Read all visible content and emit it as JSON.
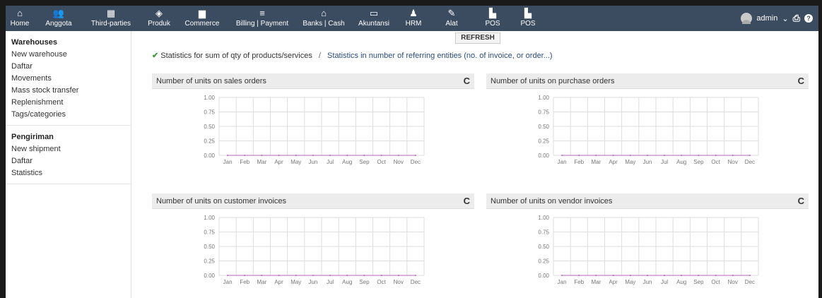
{
  "nav": {
    "items": [
      {
        "label": "Home",
        "icon": "house-icon",
        "glyph": "⌂"
      },
      {
        "label": "Anggota",
        "icon": "members-icon",
        "glyph": "👥"
      },
      {
        "label": "Third-parties",
        "icon": "building-icon",
        "glyph": "▦"
      },
      {
        "label": "Produk",
        "icon": "cube-icon",
        "glyph": "◈"
      },
      {
        "label": "Commerce",
        "icon": "briefcase-icon",
        "glyph": "▆"
      },
      {
        "label": "Billing | Payment",
        "icon": "coins-icon",
        "glyph": "≡"
      },
      {
        "label": "Banks | Cash",
        "icon": "bank-icon",
        "glyph": "⌂"
      },
      {
        "label": "Akuntansi",
        "icon": "calculator-icon",
        "glyph": "▭"
      },
      {
        "label": "HRM",
        "icon": "user-icon",
        "glyph": "♟"
      },
      {
        "label": "Alat",
        "icon": "wrench-icon",
        "glyph": "✎"
      },
      {
        "label": "POS",
        "icon": "pos-icon",
        "glyph": "▙"
      },
      {
        "label": "POS",
        "icon": "pos-icon",
        "glyph": "▙"
      }
    ],
    "active_index": 3,
    "user": "admin",
    "user_caret": "⌄",
    "print_glyph": "⎙",
    "help_glyph": "?"
  },
  "refresh_label": "REFRESH",
  "leftmenu": {
    "warehouses_title": "Warehouses",
    "warehouse_links": [
      "New warehouse",
      "Daftar",
      "Movements",
      "Mass stock transfer",
      "Replenishment",
      "Tags/categories"
    ],
    "shipping_title": "Pengiriman",
    "shipping_links": [
      "New shipment",
      "Daftar",
      "Statistics"
    ]
  },
  "stats": {
    "check": "✔",
    "current": "Statistics for sum of qty of products/services",
    "separator": "/",
    "alternative": "Statistics in number of referring entities (no. of invoice, or order...)"
  },
  "panels": [
    {
      "title": "Number of units on sales orders",
      "reload": "C"
    },
    {
      "title": "Number of units on purchase orders",
      "reload": "C"
    },
    {
      "title": "Number of units on customer invoices",
      "reload": "C"
    },
    {
      "title": "Number of units on vendor invoices",
      "reload": "C"
    }
  ],
  "colors": {
    "nav_bg": "#3b4b60",
    "line_color": "#b566b5",
    "grid": "#dddddd"
  },
  "chart_data": [
    {
      "type": "line",
      "categories": [
        "Jan",
        "Feb",
        "Mar",
        "Apr",
        "May",
        "Jun",
        "Jul",
        "Aug",
        "Sep",
        "Oct",
        "Nov",
        "Dec"
      ],
      "series": [
        {
          "values": [
            0,
            0,
            0,
            0,
            0,
            0,
            0,
            0,
            0,
            0,
            0,
            0
          ]
        }
      ],
      "yticks": [
        "1.00",
        "0.75",
        "0.50",
        "0.25",
        "0.00"
      ],
      "ylim": [
        0,
        1
      ],
      "grid": true
    },
    {
      "type": "line",
      "categories": [
        "Jan",
        "Feb",
        "Mar",
        "Apr",
        "May",
        "Jun",
        "Jul",
        "Aug",
        "Sep",
        "Oct",
        "Nov",
        "Dec"
      ],
      "series": [
        {
          "values": [
            0,
            0,
            0,
            0,
            0,
            0,
            0,
            0,
            0,
            0,
            0,
            0
          ]
        }
      ],
      "yticks": [
        "1.00",
        "0.75",
        "0.50",
        "0.25",
        "0.00"
      ],
      "ylim": [
        0,
        1
      ],
      "grid": true
    },
    {
      "type": "line",
      "categories": [
        "Jan",
        "Feb",
        "Mar",
        "Apr",
        "May",
        "Jun",
        "Jul",
        "Aug",
        "Sep",
        "Oct",
        "Nov",
        "Dec"
      ],
      "series": [
        {
          "values": [
            0,
            0,
            0,
            0,
            0,
            0,
            0,
            0,
            0,
            0,
            0,
            0
          ]
        }
      ],
      "yticks": [
        "1.00",
        "0.75",
        "0.50",
        "0.25",
        "0.00"
      ],
      "ylim": [
        0,
        1
      ],
      "grid": true
    },
    {
      "type": "line",
      "categories": [
        "Jan",
        "Feb",
        "Mar",
        "Apr",
        "May",
        "Jun",
        "Jul",
        "Aug",
        "Sep",
        "Oct",
        "Nov",
        "Dec"
      ],
      "series": [
        {
          "values": [
            0,
            0,
            0,
            0,
            0,
            0,
            0,
            0,
            0,
            0,
            0,
            0
          ]
        }
      ],
      "yticks": [
        "1.00",
        "0.75",
        "0.50",
        "0.25",
        "0.00"
      ],
      "ylim": [
        0,
        1
      ],
      "grid": true
    }
  ]
}
